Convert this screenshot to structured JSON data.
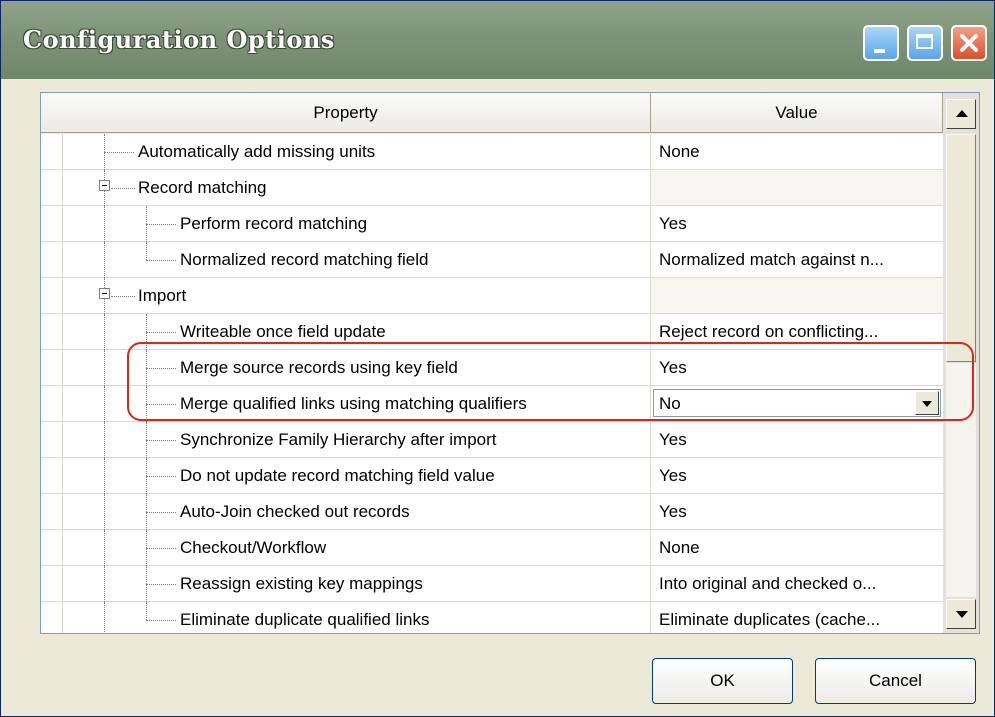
{
  "window": {
    "title": "Configuration Options"
  },
  "grid": {
    "columns": {
      "property": "Property",
      "value": "Value"
    },
    "rows": [
      {
        "property": "Automatically add missing units",
        "value": "None"
      },
      {
        "property": "Record matching",
        "value": ""
      },
      {
        "property": "Perform record matching",
        "value": "Yes"
      },
      {
        "property": "Normalized record matching field",
        "value": "Normalized match against n..."
      },
      {
        "property": "Import",
        "value": ""
      },
      {
        "property": "Writeable once field update",
        "value": "Reject record on conflicting..."
      },
      {
        "property": "Merge source records using key field",
        "value": "Yes"
      },
      {
        "property": "Merge qualified links using matching qualifiers",
        "value": "No"
      },
      {
        "property": "Synchronize Family Hierarchy after import",
        "value": "Yes"
      },
      {
        "property": "Do not update record matching field value",
        "value": "Yes"
      },
      {
        "property": "Auto-Join checked out records",
        "value": "Yes"
      },
      {
        "property": "Checkout/Workflow",
        "value": "None"
      },
      {
        "property": "Reassign existing key mappings",
        "value": "Into original and checked o..."
      },
      {
        "property": "Eliminate duplicate qualified links",
        "value": "Eliminate duplicates (cache..."
      }
    ]
  },
  "buttons": {
    "ok": "OK",
    "cancel": "Cancel"
  },
  "colors": {
    "highlight": "#e2231a",
    "titlebar": "#7e9478"
  }
}
